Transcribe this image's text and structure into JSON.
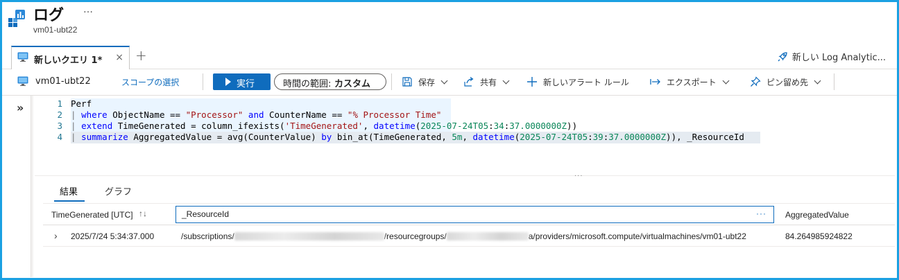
{
  "header": {
    "title": "ログ",
    "more": "…",
    "subtitle": "vm01-ubt22"
  },
  "tabs": {
    "query_tab_label": "新しいクエリ 1*",
    "close": "×",
    "add": "+",
    "new_log_analytics": "新しい Log Analytic..."
  },
  "toolbar": {
    "scope_name": "vm01-ubt22",
    "scope_select": "スコープの選択",
    "run": "実行",
    "time_range_label": "時間の範囲:",
    "time_range_value": "カスタム",
    "save": "保存",
    "share": "共有",
    "new_alert": "新しいアラート ルール",
    "export": "エクスポート",
    "pin": "ピン留め先"
  },
  "editor": {
    "side_toggle": "»",
    "line_numbers": [
      "1",
      "2",
      "3",
      "4"
    ],
    "splitter": "..."
  },
  "results": {
    "tab_results": "結果",
    "tab_chart": "グラフ",
    "columns": {
      "time_generated": "TimeGenerated [UTC]",
      "sort": "↑↓",
      "resource_id": "_ResourceId",
      "resource_more": "···",
      "aggregated_value": "AggregatedValue"
    },
    "rows": [
      {
        "expand": "›",
        "time_generated": "2025/7/24 5:34:37.000",
        "resource_id_part1": "/subscriptions/",
        "resource_id_part2": "/resourcegroups/",
        "resource_id_part3": "a/providers/microsoft.compute/virtualmachines/vm01-ubt22",
        "aggregated_value": "84.264985924822"
      }
    ]
  },
  "colors": {
    "frame": "#1ba1e2",
    "accent": "#0f6cbd",
    "keyword": "#0000ff",
    "string": "#a31515",
    "number": "#098658"
  }
}
